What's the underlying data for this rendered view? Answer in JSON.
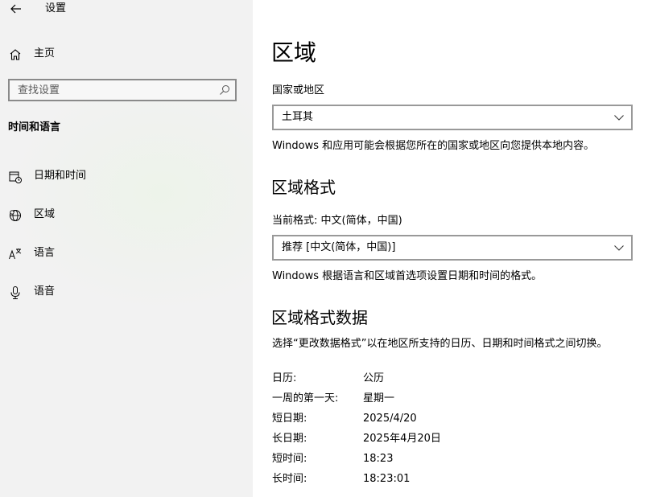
{
  "sidebar": {
    "title": "设置",
    "home_label": "主页",
    "search_placeholder": "查找设置",
    "section_header": "时间和语言",
    "items": [
      {
        "label": "日期和时间",
        "icon": "calendar-clock-icon"
      },
      {
        "label": "区域",
        "icon": "globe-icon"
      },
      {
        "label": "语言",
        "icon": "language-icon"
      },
      {
        "label": "语音",
        "icon": "microphone-icon"
      }
    ]
  },
  "main": {
    "title": "区域",
    "country_label": "国家或地区",
    "country_value": "土耳其",
    "country_desc": "Windows 和应用可能会根据您所在的国家或地区向您提供本地内容。",
    "format_heading": "区域格式",
    "current_format_label": "当前格式: 中文(简体，中国)",
    "format_value": "推荐 [中文(简体，中国)]",
    "format_desc": "Windows 根据语言和区域首选项设置日期和时间的格式。",
    "data_heading": "区域格式数据",
    "data_desc": "选择“更改数据格式”以在地区所支持的日历、日期和时间格式之间切换。",
    "rows": [
      {
        "label": "日历:",
        "value": "公历"
      },
      {
        "label": "一周的第一天:",
        "value": "星期一"
      },
      {
        "label": "短日期:",
        "value": "2025/4/20"
      },
      {
        "label": "长日期:",
        "value": "2025年4月20日"
      },
      {
        "label": "短时间:",
        "value": "18:23"
      },
      {
        "label": "长时间:",
        "value": "18:23:01"
      }
    ]
  }
}
